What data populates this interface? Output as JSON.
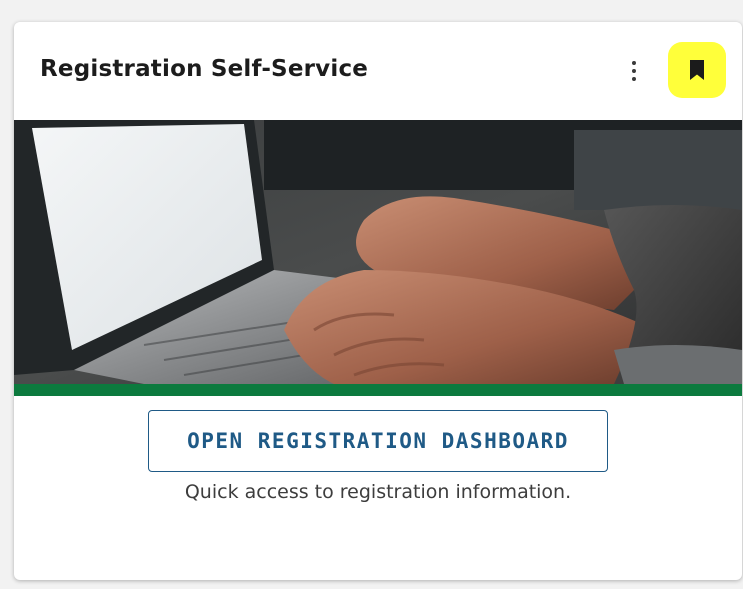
{
  "card": {
    "title": "Registration Self-Service",
    "menu_icon": "more-vertical-icon",
    "bookmark_icon": "bookmark-icon",
    "image_description_icon": "laptop-typing-image",
    "button_label": "OPEN REGISTRATION DASHBOARD",
    "description": "Quick access to registration information."
  },
  "colors": {
    "accent_green": "#0c7a3e",
    "button_blue": "#1f5a86",
    "highlight_yellow": "#ffff3a"
  }
}
